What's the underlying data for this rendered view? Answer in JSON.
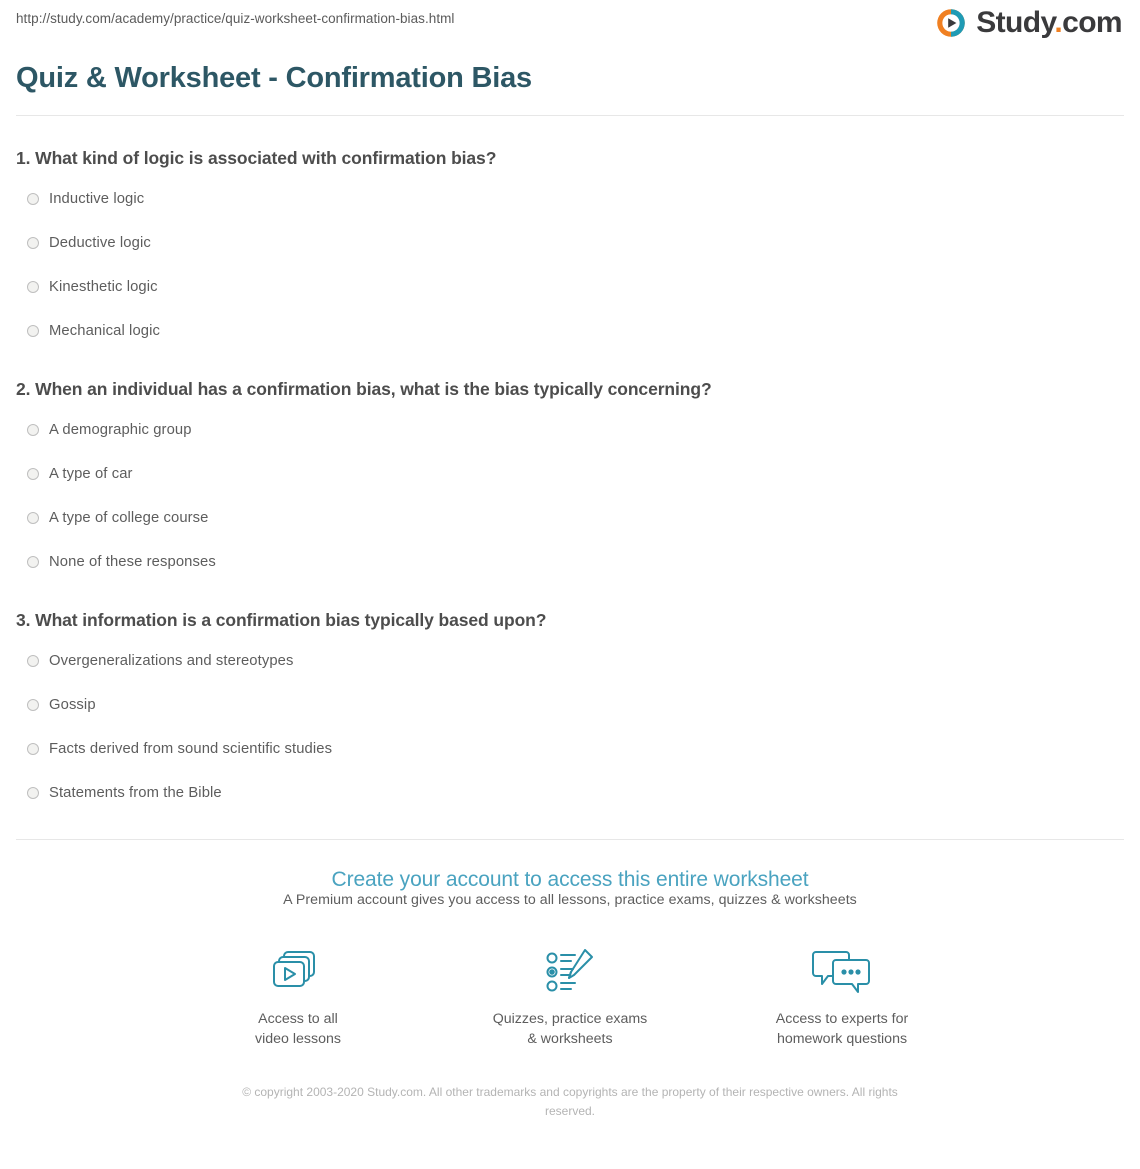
{
  "header": {
    "url": "http://study.com/academy/practice/quiz-worksheet-confirmation-bias.html",
    "brand_name": "Study",
    "brand_dot": ".",
    "brand_tld": "com",
    "brand_colors": {
      "orange": "#f08022",
      "teal": "#1f9bb5",
      "text": "#3a3a3c"
    }
  },
  "page_title": "Quiz & Worksheet - Confirmation Bias",
  "title_color": "#2d5765",
  "questions": [
    {
      "text": "1. What kind of logic is associated with confirmation bias?",
      "answers": [
        "Inductive logic",
        "Deductive logic",
        "Kinesthetic logic",
        "Mechanical logic"
      ]
    },
    {
      "text": "2. When an individual has a confirmation bias, what is the bias typically concerning?",
      "answers": [
        "A demographic group",
        "A type of car",
        "A type of college course",
        "None of these responses"
      ]
    },
    {
      "text": "3. What information is a confirmation bias typically based upon?",
      "answers": [
        "Overgeneralizations and stereotypes",
        "Gossip",
        "Facts derived from sound scientific studies",
        "Statements from the Bible"
      ]
    }
  ],
  "cta": {
    "heading": "Create your account to access this entire worksheet",
    "subheading": "A Premium account gives you access to all lessons, practice exams, quizzes & worksheets",
    "accent_color": "#4aa3c0",
    "features": [
      {
        "icon": "video-lessons-icon",
        "line1": "Access to all",
        "line2": "video lessons"
      },
      {
        "icon": "quiz-checklist-pencil-icon",
        "line1": "Quizzes, practice exams",
        "line2": "& worksheets"
      },
      {
        "icon": "chat-bubbles-icon",
        "line1": "Access to experts for",
        "line2": "homework questions"
      }
    ]
  },
  "copyright": "© copyright 2003-2020 Study.com. All other trademarks and copyrights are the property of their respective owners. All rights reserved."
}
